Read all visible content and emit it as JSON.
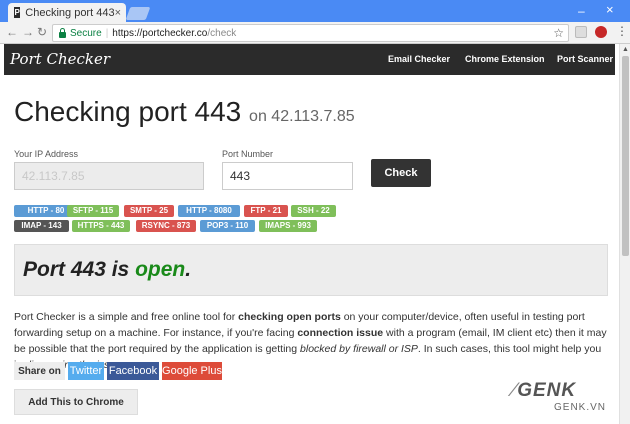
{
  "browser": {
    "tab_title": "Checking port 443",
    "tab_close": "×",
    "tab_favicon": "P",
    "secure_label": "Secure",
    "url_host": "https://portchecker.co",
    "url_path": "/check",
    "ext_icons": [
      "extension-icon",
      "shield-extension-icon"
    ]
  },
  "nav": {
    "logo": "Port Checker",
    "links": [
      "Email Checker",
      "Chrome Extension",
      "Port Scanner"
    ]
  },
  "header": {
    "title": "Checking port 443",
    "subtitle": "on 42.113.7.85"
  },
  "form": {
    "ip_label": "Your IP Address",
    "ip_value": "42.113.7.85",
    "port_label": "Port Number",
    "port_value": "443",
    "check_label": "Check"
  },
  "tags": [
    {
      "label": "HTTP - 80",
      "color": "#5b9bd5"
    },
    {
      "label": "SFTP - 115",
      "color": "#7fbf5a"
    },
    {
      "label": "SMTP - 25",
      "color": "#d9534f"
    },
    {
      "label": "HTTP - 8080",
      "color": "#5b9bd5"
    },
    {
      "label": "FTP - 21",
      "color": "#d9534f"
    },
    {
      "label": "SSH - 22",
      "color": "#7fbf5a"
    },
    {
      "label": "IMAP - 143",
      "color": "#555555"
    },
    {
      "label": "HTTPS - 443",
      "color": "#7fbf5a"
    },
    {
      "label": "RSYNC - 873",
      "color": "#d9534f"
    },
    {
      "label": "POP3 - 110",
      "color": "#5b9bd5"
    },
    {
      "label": "IMAPS - 993",
      "color": "#7fbf5a"
    }
  ],
  "result": {
    "prefix": "Port 443 is",
    "status": "open",
    "suffix": ".",
    "status_color": "#1a8a1a"
  },
  "description": {
    "p1": "Port Checker is a simple and free online tool for ",
    "b1": "checking open ports",
    "p2": " on your computer/device, often useful in testing port forwarding setup on a machine. For instance, if you're facing ",
    "b2": "connection issue",
    "p3": " with a program (email, IM client etc) then it may be possible that the port required by the application is getting ",
    "i1": "blocked by firewall or ISP",
    "p4": ". In such cases, this tool might help you in ",
    "i2": "diagnosing the issue",
    "p5": "."
  },
  "share": {
    "label": "Share on",
    "buttons": [
      {
        "label": "Twitter",
        "color": "#55acee"
      },
      {
        "label": "Facebook",
        "color": "#3b5998"
      },
      {
        "label": "Google Plus",
        "color": "#dd4b39"
      }
    ]
  },
  "add_chrome": "Add This to Chrome",
  "watermark": {
    "brand": "GENK",
    "domain": "GENK.VN"
  }
}
